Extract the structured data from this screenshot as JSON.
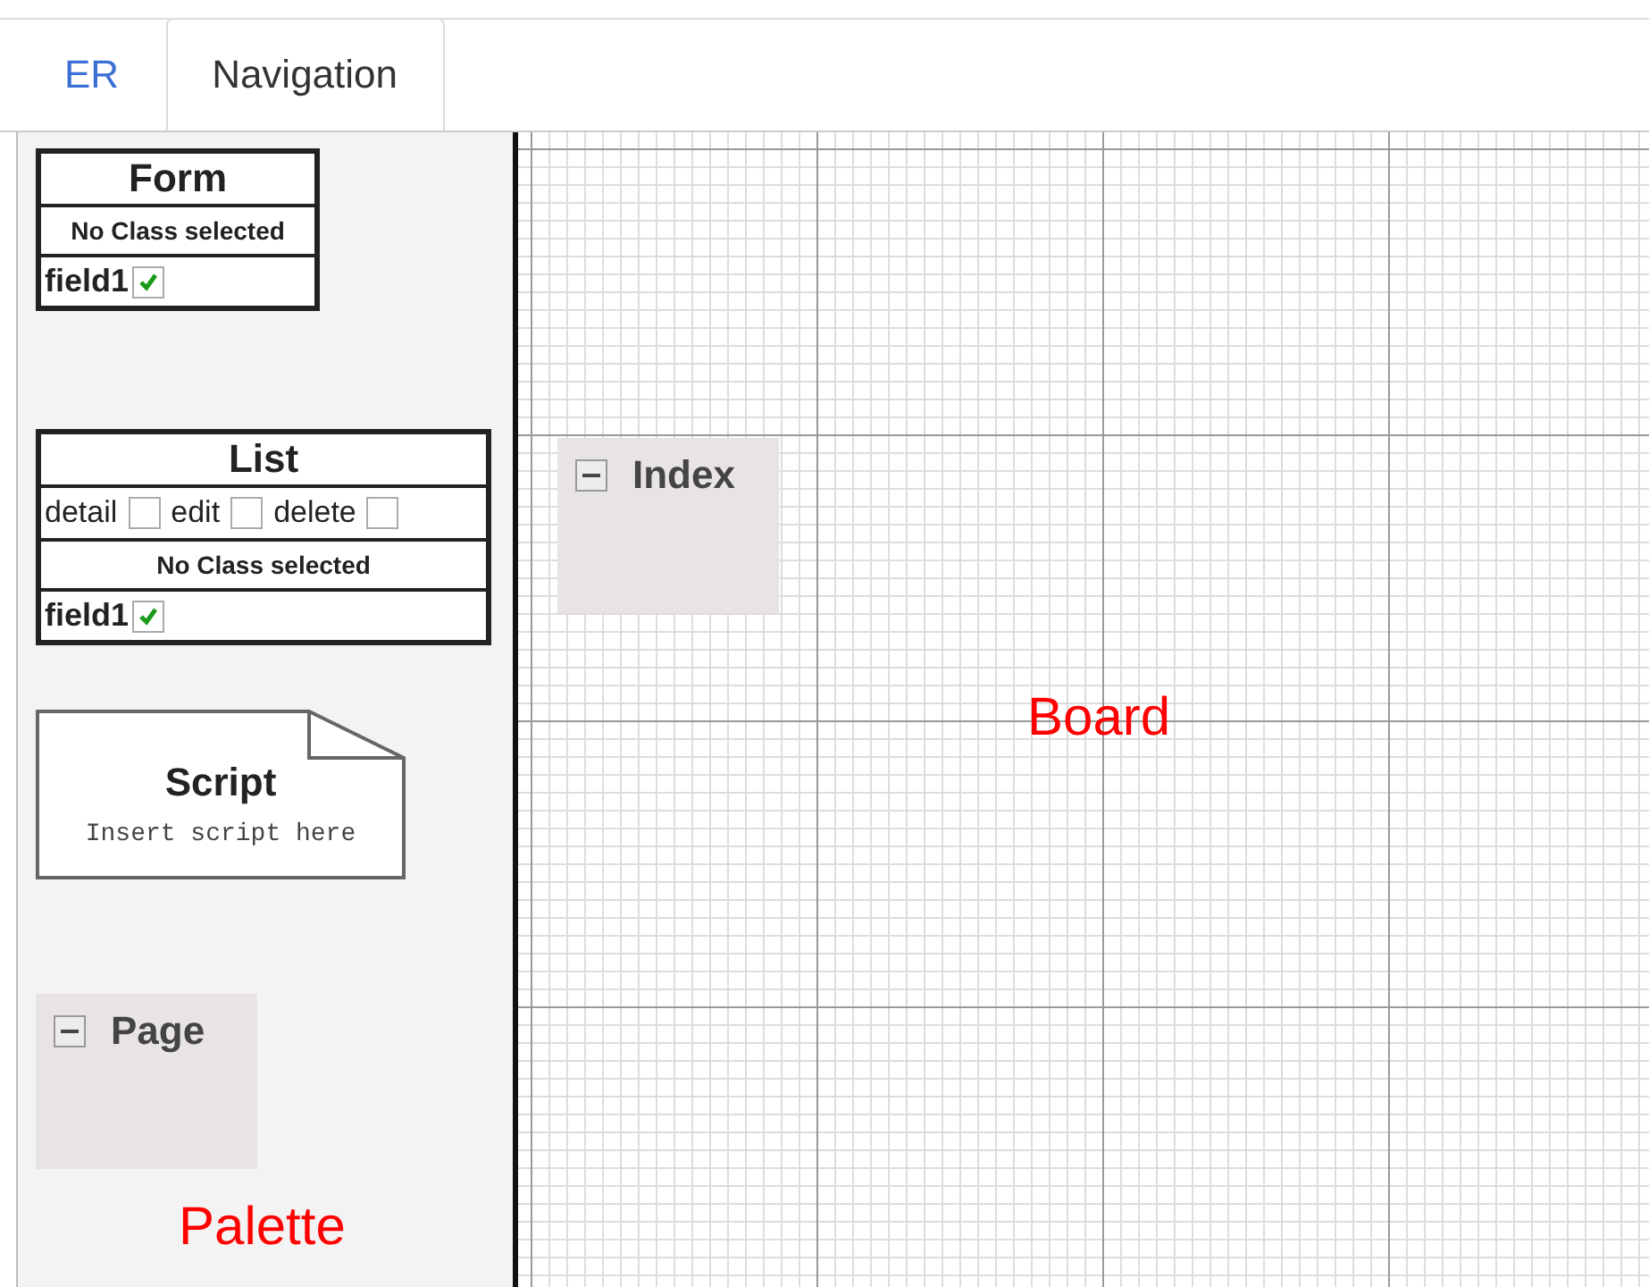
{
  "tabs": [
    {
      "label": "ER",
      "selected": false
    },
    {
      "label": "Navigation",
      "selected": true
    }
  ],
  "palette": {
    "label": "Palette",
    "nodes": [
      {
        "kind": "form",
        "title": "Form",
        "class_text": "No Class selected",
        "fields": [
          {
            "name": "field1",
            "checked": true
          }
        ]
      },
      {
        "kind": "list",
        "title": "List",
        "actions": [
          {
            "label": "detail",
            "checked": false
          },
          {
            "label": "edit",
            "checked": false
          },
          {
            "label": "delete",
            "checked": false
          }
        ],
        "class_text": "No Class selected",
        "fields": [
          {
            "name": "field1",
            "checked": true
          }
        ]
      },
      {
        "kind": "script",
        "title": "Script",
        "text": "Insert script here"
      },
      {
        "kind": "group",
        "title": "Page",
        "expanded": true
      }
    ]
  },
  "board": {
    "label": "Board",
    "nodes": [
      {
        "kind": "group",
        "title": "Index",
        "expanded": true
      }
    ]
  }
}
